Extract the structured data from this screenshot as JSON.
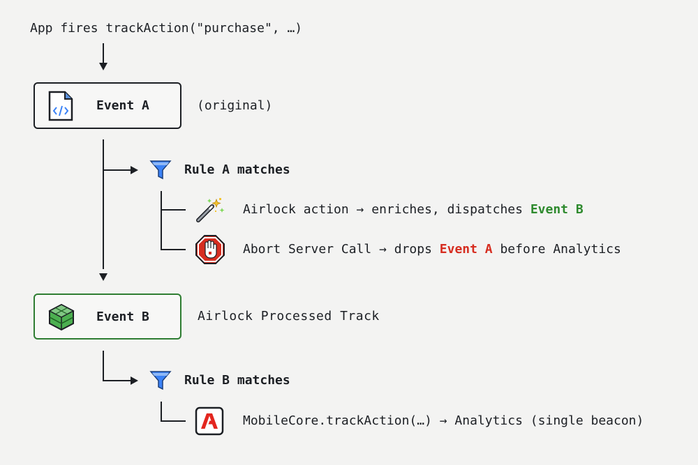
{
  "header": {
    "text": "App fires trackAction(\"purchase\", …)"
  },
  "event_a": {
    "label": "Event A",
    "note": "(original)"
  },
  "rule_a": {
    "title": "Rule A matches",
    "actions": [
      {
        "prefix": "Airlock action → enriches, dispatches ",
        "highlight": "Event B",
        "suffix": ""
      },
      {
        "prefix": "Abort Server Call → drops ",
        "highlight": "Event A",
        "suffix": " before Analytics"
      }
    ]
  },
  "event_b": {
    "label": "Event B",
    "note": "Airlock Processed Track"
  },
  "rule_b": {
    "title": "Rule B matches",
    "actions": [
      {
        "prefix": "MobileCore.trackAction(…) → Analytics (single beacon)"
      }
    ]
  },
  "icons": {
    "event_a": "code-file-icon",
    "event_b": "green-cube-icon",
    "rule": "funnel-icon",
    "airlock": "magic-wand-icon",
    "abort": "stop-hand-icon",
    "adobe": "adobe-logo-icon"
  },
  "colors": {
    "event_b_accent": "#2e7d32",
    "highlight_green": "#2e8a2e",
    "highlight_red": "#d62d20",
    "funnel": "#3b82f6"
  }
}
